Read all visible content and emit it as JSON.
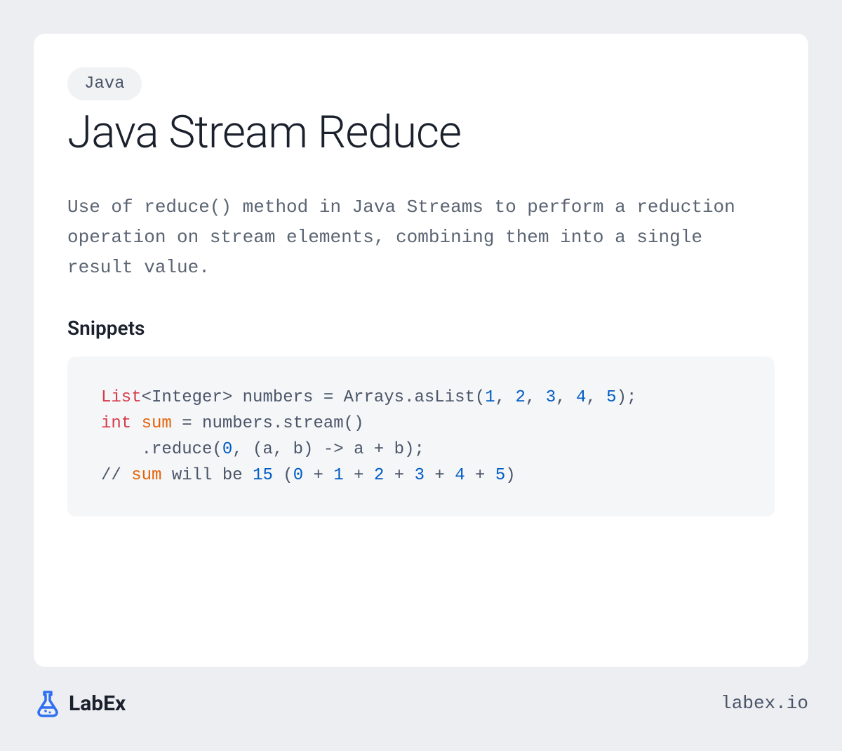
{
  "card": {
    "tag": "Java",
    "title": "Java Stream Reduce",
    "description": "Use of reduce() method in Java Streams to perform a reduction operation on stream elements, combining them into a single result value.",
    "snippets_heading": "Snippets",
    "code": {
      "line1": {
        "t1": "List",
        "t2": "<Integer> numbers = Arrays.asList(",
        "n1": "1",
        "c": ", ",
        "n2": "2",
        "n3": "3",
        "n4": "4",
        "n5": "5",
        "t3": ");"
      },
      "line2": {
        "t1": "int",
        "t2": " ",
        "t3": "sum",
        "t4": " = numbers.stream()"
      },
      "line3": {
        "t1": "    .reduce(",
        "n1": "0",
        "t2": ", (a, b) -> a + b);"
      },
      "line4": {
        "t1": "// ",
        "t2": "sum",
        "t3": " will be ",
        "n1": "15",
        "t4": " (",
        "n2": "0",
        "t5": " + ",
        "n3": "1",
        "n4": "2",
        "n5": "3",
        "n6": "4",
        "n7": "5",
        "t6": ")"
      }
    }
  },
  "footer": {
    "brand": "LabEx",
    "url": "labex.io"
  }
}
